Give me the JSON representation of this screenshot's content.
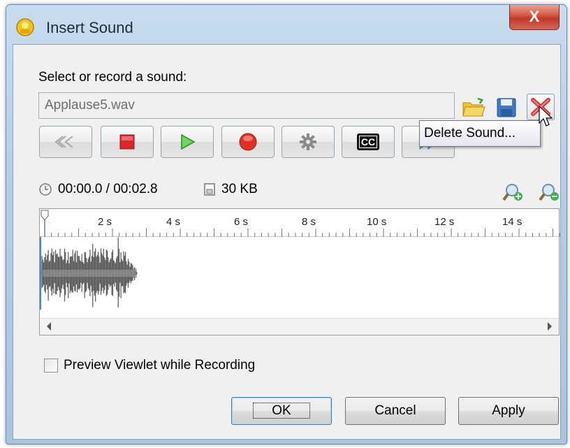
{
  "window": {
    "title": "Insert Sound",
    "close_label": "X"
  },
  "sound": {
    "prompt": "Select or record a sound:",
    "file_name": "Applause5.wav"
  },
  "toolbar": {
    "icons": [
      "open-folder-icon",
      "save-icon",
      "delete-icon"
    ],
    "transport": [
      "rewind-icon",
      "stop-icon",
      "play-icon",
      "record-icon",
      "settings-icon",
      "closed-captions-icon",
      "fast-forward-icon"
    ],
    "cc_label": "CC"
  },
  "tooltip": {
    "text": "Delete Sound..."
  },
  "info": {
    "time": "00:00.0 / 00:02.8",
    "size": "30 KB"
  },
  "timeline": {
    "ruler_labels": [
      "2 s",
      "4 s",
      "6 s",
      "8 s",
      "10 s",
      "12 s",
      "14 s"
    ]
  },
  "preview": {
    "label": "Preview Viewlet while Recording",
    "checked": false
  },
  "buttons": {
    "ok": "OK",
    "cancel": "Cancel",
    "apply": "Apply"
  },
  "colors": {
    "stop": "#d9262b",
    "play": "#3cae3a",
    "record": "#e03020",
    "waveform": "#555555",
    "close": "#c0392b"
  }
}
